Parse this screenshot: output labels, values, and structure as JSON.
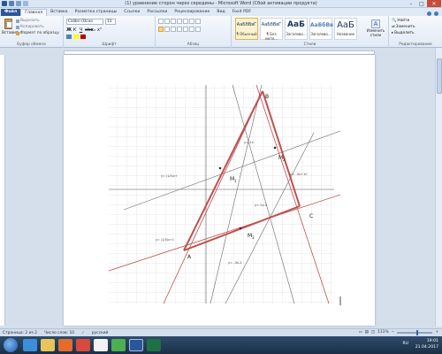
{
  "window": {
    "title": "(1) уравнение сторон через середины - Microsoft Word (Сбой активации продукта)"
  },
  "tabs": [
    {
      "label": "Файл"
    },
    {
      "label": "Главная"
    },
    {
      "label": "Вставка"
    },
    {
      "label": "Разметка страницы"
    },
    {
      "label": "Ссылки"
    },
    {
      "label": "Рассылки"
    },
    {
      "label": "Рецензирование"
    },
    {
      "label": "Вид"
    },
    {
      "label": "Foxit PDF"
    }
  ],
  "ribbon": {
    "clipboard": {
      "paste": "Вставить",
      "cut": "Вырезать",
      "copy": "Копировать",
      "format_painter": "Формат по образцу",
      "group": "Буфер обмена"
    },
    "font": {
      "font_name": "Calibri (Осно",
      "font_size": "11",
      "group": "Шрифт"
    },
    "paragraph": {
      "group": "Абзац"
    },
    "styles": {
      "items": [
        {
          "sample": "AaБбВвГ",
          "name": "¶ Обычный"
        },
        {
          "sample": "AaБбВвГ",
          "name": "¶ Без инте..."
        },
        {
          "sample": "AaБ",
          "name": "Заголово..."
        },
        {
          "sample": "AaБбВв",
          "name": "Заголово..."
        },
        {
          "sample": "AaБ",
          "name": "Название"
        }
      ],
      "change_styles": "Изменить стили",
      "group": "Стили"
    },
    "editing": {
      "find": "Найти",
      "replace": "Заменить",
      "select": "Выделить",
      "group": "Редактирование"
    }
  },
  "document": {
    "points": {
      "A": "A",
      "B": "B",
      "C": "C",
      "M1": "M",
      "M2": "M",
      "M3": "M",
      "m1_sub": "1",
      "m2_sub": "2",
      "m3_sub": "3"
    },
    "formulas": {
      "ab_line": "y= 2x",
      "bc_line": "y= -3x+10",
      "m1m2_line": "y= 2x-5",
      "m3_line": "y= -3x-2",
      "m1_formula": "y= (1/3)x+",
      "ac_formula": "y= (1/3)x+1"
    },
    "colors": {
      "triangle": "#c0504d",
      "grid": "#c8c8c8",
      "axes": "#555555",
      "midlines": "#6a6a6a"
    }
  },
  "statusbar": {
    "page": "Страница: 2 из 2",
    "words": "Число слов: 10",
    "language": "русский",
    "zoom": "111%"
  },
  "taskbar": {
    "lang": "RU",
    "time": "19:01",
    "date": "21.04.2017"
  }
}
